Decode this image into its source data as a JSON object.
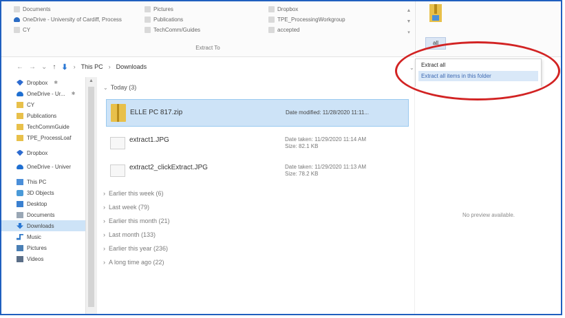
{
  "ribbon": {
    "col1": [
      "Documents",
      "OneDrive - University of Cardiff, Process",
      "CY"
    ],
    "col2": [
      "Pictures",
      "Publications",
      "TechComm/Guides"
    ],
    "col3": [
      "Dropbox",
      "TPE_ProcessingWorkgroup",
      "accepted"
    ],
    "group_label": "Extract To",
    "all_label": "all"
  },
  "address": {
    "path": [
      "This PC",
      "Downloads"
    ]
  },
  "dropdown": {
    "title": "Extract all",
    "item": "Extract all items in this folder"
  },
  "sidebar": {
    "items": [
      {
        "label": "Dropbox",
        "icon": "dropbox-icon",
        "pinned": true
      },
      {
        "label": "OneDrive - Ur...",
        "icon": "cloud-icon",
        "pinned": true
      },
      {
        "label": "CY",
        "icon": "folder-icon"
      },
      {
        "label": "Publications",
        "icon": "folder-icon"
      },
      {
        "label": "TechCommGuide",
        "icon": "folder-icon"
      },
      {
        "label": "TPE_ProcessLoaf",
        "icon": "folder-icon"
      },
      {
        "label": "Dropbox",
        "icon": "dropbox-icon"
      },
      {
        "label": "OneDrive - Univer",
        "icon": "cloud-icon"
      },
      {
        "label": "This PC",
        "icon": "pc-icon"
      },
      {
        "label": "3D Objects",
        "icon": "cube-icon"
      },
      {
        "label": "Desktop",
        "icon": "desktop-icon"
      },
      {
        "label": "Documents",
        "icon": "document-icon"
      },
      {
        "label": "Downloads",
        "icon": "download-icon",
        "selected": true
      },
      {
        "label": "Music",
        "icon": "music-icon"
      },
      {
        "label": "Pictures",
        "icon": "pictures-icon"
      },
      {
        "label": "Videos",
        "icon": "videos-icon"
      }
    ]
  },
  "content": {
    "today_header": "Today (3)",
    "files": [
      {
        "name": "ELLE PC 817.zip",
        "meta1": "Date modified: 11/28/2020 11:11...",
        "meta2": "",
        "type": "zip",
        "selected": true
      },
      {
        "name": "extract1.JPG",
        "meta1": "Date taken: 11/29/2020 11:14 AM",
        "meta2": "Size: 82.1 KB",
        "type": "image"
      },
      {
        "name": "extract2_clickExtract.JPG",
        "meta1": "Date taken: 11/29/2020 11:13 AM",
        "meta2": "Size: 78.2 KB",
        "type": "image"
      }
    ],
    "collapsed_groups": [
      "Earlier this week (6)",
      "Last week (79)",
      "Earlier this month (21)",
      "Last month (133)",
      "Earlier this year (236)",
      "A long time ago (22)"
    ]
  },
  "preview": {
    "text": "No preview available."
  },
  "colors": {
    "accent": "#1f5fbf",
    "selection": "#cde3f7",
    "annotation": "#d22323"
  }
}
